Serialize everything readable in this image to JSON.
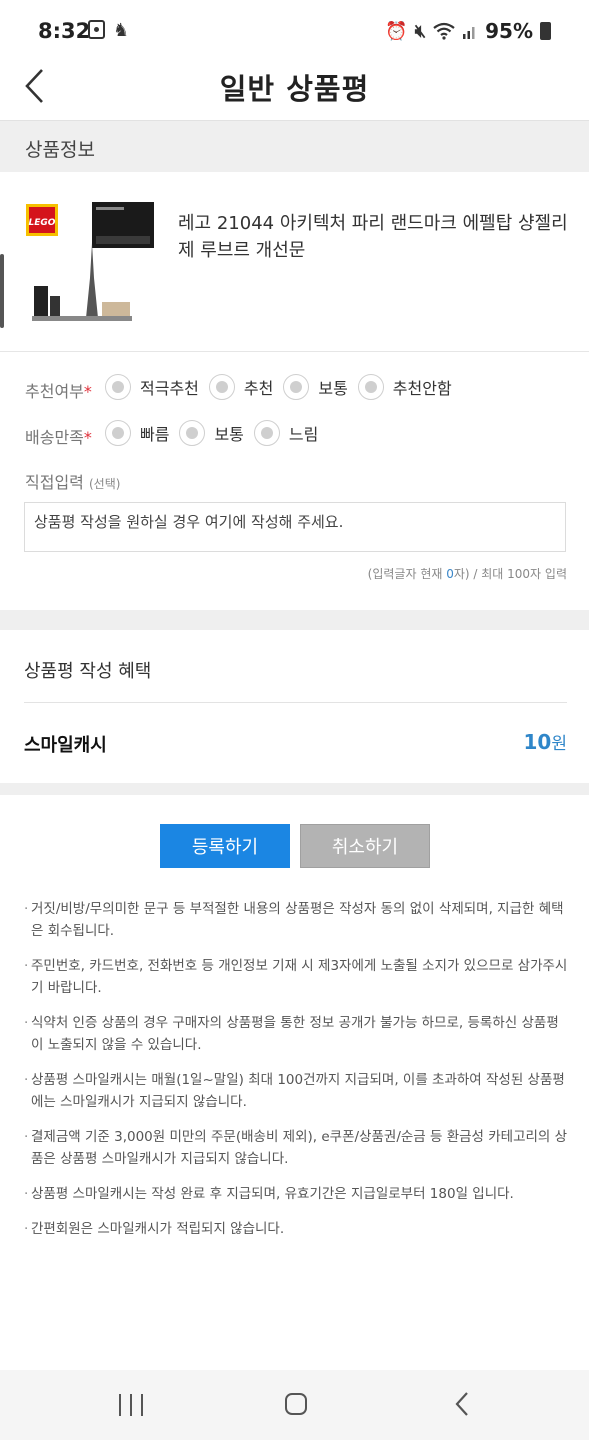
{
  "status_bar": {
    "time": "8:32",
    "battery": "95%",
    "icons": [
      "photo-icon",
      "accessibility-icon",
      "alarm-icon",
      "mute-icon",
      "wifi-icon",
      "signal-icon",
      "battery-icon"
    ]
  },
  "header": {
    "title": "일반 상품평",
    "back_icon": "chevron-left-icon"
  },
  "product_section": {
    "heading": "상품정보",
    "product_name": "레고 21044 아키텍처 파리 랜드마크 에펠탑 샹젤리제 루브르 개선문",
    "brand_logo_text": "LEGO"
  },
  "rating": {
    "recommend_label": "추천여부",
    "recommend_options": [
      "적극추천",
      "추천",
      "보통",
      "추천안함"
    ],
    "shipping_label": "배송만족",
    "shipping_options": [
      "빠름",
      "보통",
      "느림"
    ],
    "required_mark": "*"
  },
  "direct_input": {
    "label": "직접입력",
    "label_note": "(선택)",
    "placeholder": "상품평 작성을 원하실 경우 여기에 작성해 주세요.",
    "count_prefix": "(입력글자 현재 ",
    "count_value": "0",
    "count_suffix": "자) / 최대 100자 입력"
  },
  "benefit": {
    "title": "상품평 작성 혜택",
    "smile_cash_label": "스마일캐시",
    "smile_cash_value": "10",
    "smile_cash_unit": "원"
  },
  "buttons": {
    "submit": "등록하기",
    "cancel": "취소하기"
  },
  "notices": [
    "거짓/비방/무의미한 문구 등 부적절한 내용의 상품평은 작성자 동의 없이 삭제되며, 지급한 혜택은 회수됩니다.",
    "주민번호, 카드번호, 전화번호 등 개인정보 기재 시 제3자에게 노출될 소지가 있으므로 삼가주시기 바랍니다.",
    "식약처 인증 상품의 경우 구매자의 상품평을 통한 정보 공개가 불가능 하므로, 등록하신 상품평이 노출되지 않을 수 있습니다.",
    "상품평 스마일캐시는 매월(1일~말일) 최대 100건까지 지급되며, 이를 초과하여 작성된 상품평에는 스마일캐시가 지급되지 않습니다.",
    "결제금액 기준 3,000원 미만의 주문(배송비 제외), e쿠폰/상품권/순금 등 환금성 카테고리의 상품은 상품평 스마일캐시가 지급되지 않습니다.",
    "상품평 스마일캐시는 작성 완료 후 지급되며, 유효기간은 지급일로부터 180일 입니다.",
    "간편회원은 스마일캐시가 적립되지 않습니다."
  ],
  "colors": {
    "accent_blue": "#1b86e3",
    "value_blue": "#2f86c9",
    "required_red": "#e0303a",
    "cancel_gray": "#b3b3b3",
    "band_gray": "#efefef"
  }
}
